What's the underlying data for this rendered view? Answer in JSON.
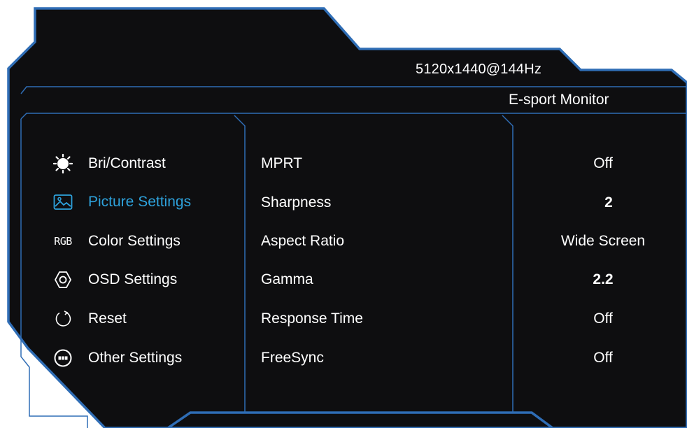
{
  "header": {
    "resolution": "5120x1440@144Hz",
    "model": "E-sport Monitor"
  },
  "colors": {
    "background": "#0e0e10",
    "border": "#2f6db5",
    "accent": "#2ea2dc",
    "text": "#ffffff"
  },
  "menu": {
    "active_index": 1,
    "items": [
      {
        "label": "Bri/Contrast",
        "icon": "sun-icon"
      },
      {
        "label": "Picture Settings",
        "icon": "picture-icon"
      },
      {
        "label": "Color Settings",
        "icon": "rgb-icon",
        "icon_text": "RGB"
      },
      {
        "label": "OSD Settings",
        "icon": "osd-icon"
      },
      {
        "label": "Reset",
        "icon": "reset-icon"
      },
      {
        "label": "Other Settings",
        "icon": "more-icon"
      }
    ]
  },
  "settings": [
    {
      "name": "MPRT",
      "value": "Off"
    },
    {
      "name": "Sharpness",
      "value": "2"
    },
    {
      "name": "Aspect Ratio",
      "value": "Wide Screen"
    },
    {
      "name": "Gamma",
      "value": "2.2"
    },
    {
      "name": "Response Time",
      "value": "Off"
    },
    {
      "name": "FreeSync",
      "value": "Off"
    }
  ]
}
